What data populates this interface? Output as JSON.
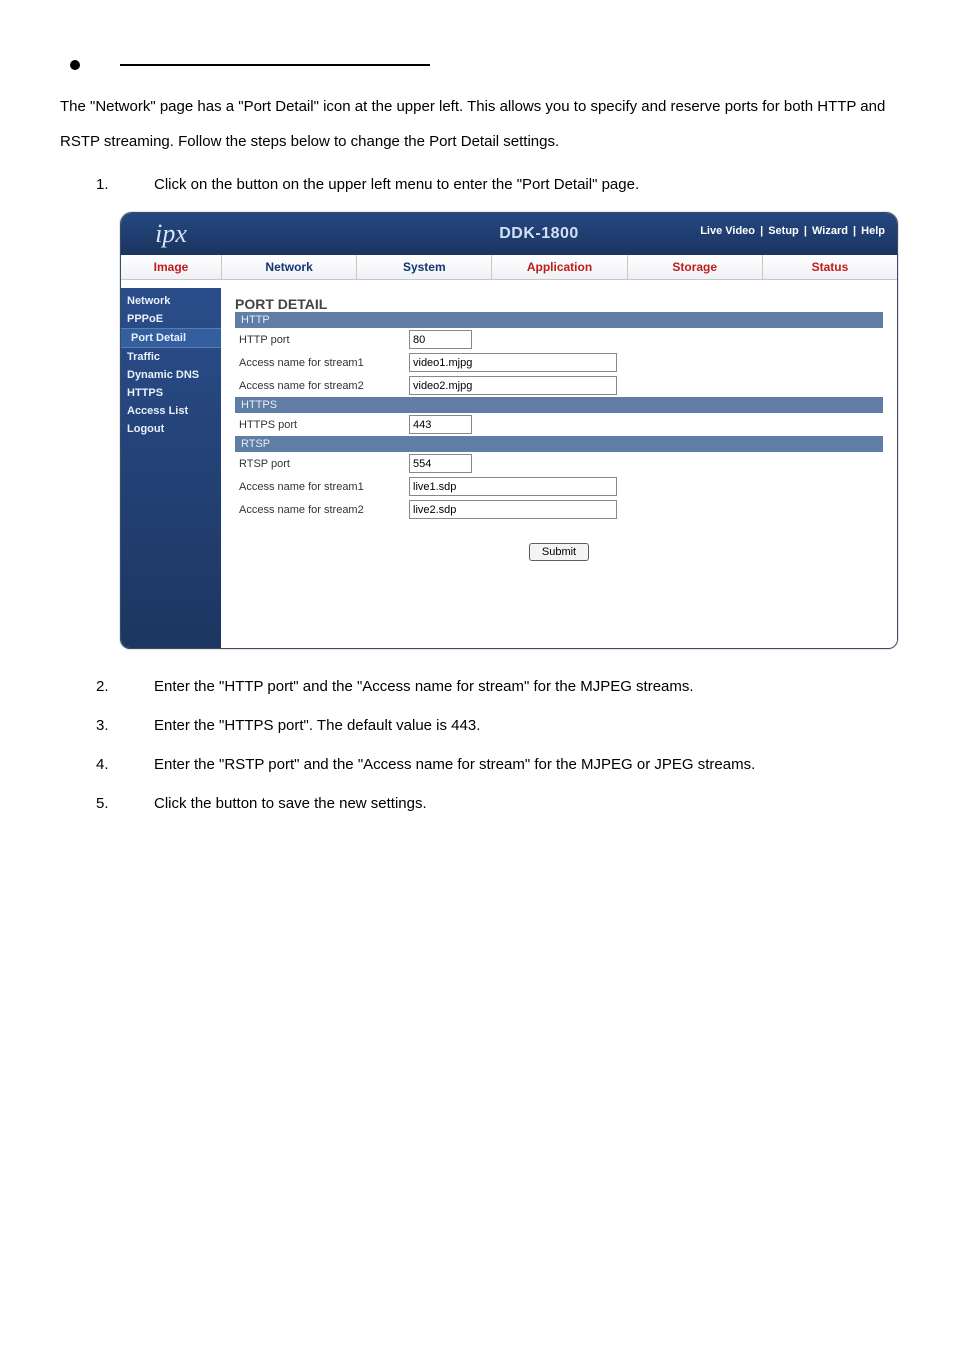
{
  "doc": {
    "intro": "The \"Network\" page has a \"Port Detail\" icon at the upper left. This allows you to specify and reserve ports for both HTTP and RSTP streaming. Follow the steps below to change the Port Detail settings.",
    "steps": [
      {
        "num": "1.",
        "text": "Click on the               button on the upper left menu to enter the \"Port Detail\" page."
      },
      {
        "num": "2.",
        "text": "Enter the \"HTTP port\" and the \"Access name for stream\" for the MJPEG streams."
      },
      {
        "num": "3.",
        "text": "Enter the \"HTTPS port\". The default value is 443."
      },
      {
        "num": "4.",
        "text": "Enter the \"RSTP port\" and the \"Access name for stream\" for the MJPEG or JPEG streams."
      },
      {
        "num": "5.",
        "text": "Click the               button to save the new settings."
      }
    ]
  },
  "app": {
    "logo": "ipx",
    "model": "DDK-1800",
    "header_links": [
      "Live Video",
      "Setup",
      "Wizard",
      "Help"
    ],
    "tabs": {
      "image": "Image",
      "network": "Network",
      "system": "System",
      "application": "Application",
      "storage": "Storage",
      "status": "Status"
    },
    "sidebar": [
      "Network",
      "PPPoE",
      "Port Detail",
      "Traffic",
      "Dynamic DNS",
      "HTTPS",
      "Access List",
      "Logout"
    ],
    "sidebar_active_index": 2,
    "panel_title": "PORT DETAIL",
    "sections": {
      "http": {
        "title": "HTTP",
        "fields": [
          {
            "label": "HTTP port",
            "value": "80",
            "short": true
          },
          {
            "label": "Access name for stream1",
            "value": "video1.mjpg"
          },
          {
            "label": "Access name for stream2",
            "value": "video2.mjpg"
          }
        ]
      },
      "https": {
        "title": "HTTPS",
        "fields": [
          {
            "label": "HTTPS port",
            "value": "443",
            "short": true
          }
        ]
      },
      "rtsp": {
        "title": "RTSP",
        "fields": [
          {
            "label": "RTSP port",
            "value": "554",
            "short": true
          },
          {
            "label": "Access name for stream1",
            "value": "live1.sdp"
          },
          {
            "label": "Access name for stream2",
            "value": "live2.sdp"
          }
        ]
      }
    },
    "submit_label": "Submit"
  }
}
